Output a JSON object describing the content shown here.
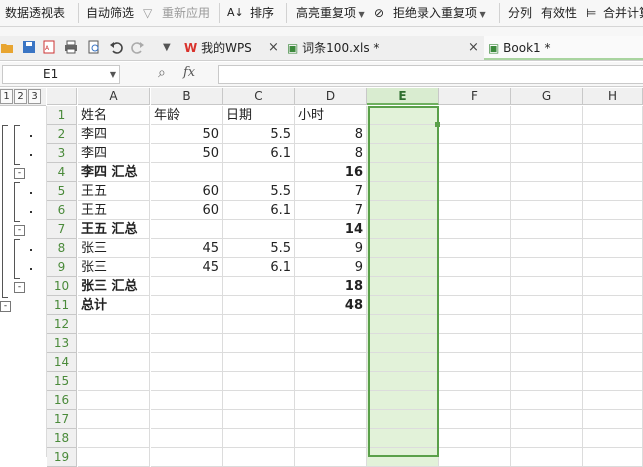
{
  "ribbon": {
    "pivot": "数据透视表",
    "autofilter": "自动筛选",
    "reapply": "重新应用",
    "sort": "排序",
    "highlight_dup": "高亮重复项",
    "reject_dup": "拒绝录入重复项",
    "split": "分列",
    "validity": "有效性",
    "merge_calc": "合并计算"
  },
  "tabs": [
    {
      "label": "我的WPS"
    },
    {
      "label": "词条100.xls *"
    },
    {
      "label": "Book1 *"
    }
  ],
  "namebox": {
    "value": "E1"
  },
  "formula": {
    "fx": "fx",
    "value": ""
  },
  "outline_levels": [
    "1",
    "2",
    "3"
  ],
  "columns": [
    "A",
    "B",
    "C",
    "D",
    "E",
    "F",
    "G",
    "H"
  ],
  "rows": [
    {
      "n": "1",
      "a": "姓名",
      "b": "年龄",
      "c": "日期",
      "d": "小时",
      "bold": false
    },
    {
      "n": "2",
      "a": "李四",
      "b": "50",
      "c": "5.5",
      "d": "8",
      "bold": false
    },
    {
      "n": "3",
      "a": "李四",
      "b": "50",
      "c": "6.1",
      "d": "8",
      "bold": false
    },
    {
      "n": "4",
      "a": "李四 汇总",
      "b": "",
      "c": "",
      "d": "16",
      "bold": true
    },
    {
      "n": "5",
      "a": "王五",
      "b": "60",
      "c": "5.5",
      "d": "7",
      "bold": false
    },
    {
      "n": "6",
      "a": "王五",
      "b": "60",
      "c": "6.1",
      "d": "7",
      "bold": false
    },
    {
      "n": "7",
      "a": "王五 汇总",
      "b": "",
      "c": "",
      "d": "14",
      "bold": true
    },
    {
      "n": "8",
      "a": "张三",
      "b": "45",
      "c": "5.5",
      "d": "9",
      "bold": false
    },
    {
      "n": "9",
      "a": "张三",
      "b": "45",
      "c": "6.1",
      "d": "9",
      "bold": false
    },
    {
      "n": "10",
      "a": "张三 汇总",
      "b": "",
      "c": "",
      "d": "18",
      "bold": true
    },
    {
      "n": "11",
      "a": "总计",
      "b": "",
      "c": "",
      "d": "48",
      "bold": true
    },
    {
      "n": "12",
      "a": "",
      "b": "",
      "c": "",
      "d": "",
      "bold": false
    },
    {
      "n": "13",
      "a": "",
      "b": "",
      "c": "",
      "d": "",
      "bold": false
    },
    {
      "n": "14",
      "a": "",
      "b": "",
      "c": "",
      "d": "",
      "bold": false
    },
    {
      "n": "15",
      "a": "",
      "b": "",
      "c": "",
      "d": "",
      "bold": false
    },
    {
      "n": "16",
      "a": "",
      "b": "",
      "c": "",
      "d": "",
      "bold": false
    },
    {
      "n": "17",
      "a": "",
      "b": "",
      "c": "",
      "d": "",
      "bold": false
    },
    {
      "n": "18",
      "a": "",
      "b": "",
      "c": "",
      "d": "",
      "bold": false
    },
    {
      "n": "19",
      "a": "",
      "b": "",
      "c": "",
      "d": "",
      "bold": false
    }
  ],
  "colors": {
    "accent": "#5aa04a",
    "selection_fill": "#e2f2d9",
    "wps_red": "#d9312b"
  }
}
